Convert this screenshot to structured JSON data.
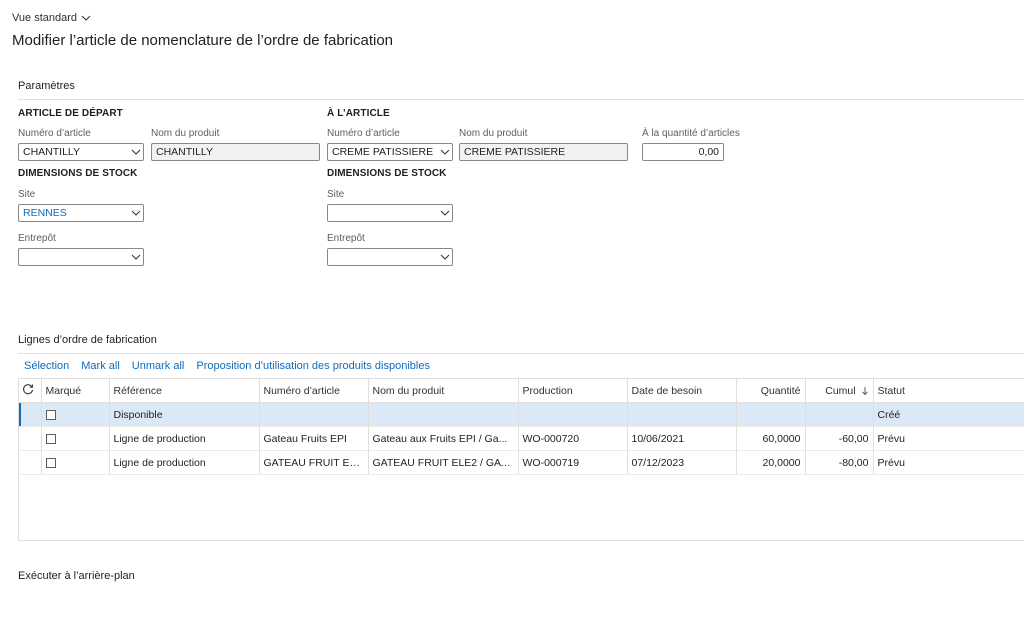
{
  "header": {
    "view_label": "Vue standard",
    "title": "Modifier l’article de nomenclature de l’ordre de fabrication"
  },
  "parameters": {
    "section_label": "Paramètres",
    "from": {
      "heading": "ARTICLE DE DÉPART",
      "item_number_label": "Numéro d’article",
      "item_number_value": "CHANTILLY",
      "product_name_label": "Nom du produit",
      "product_name_value": "CHANTILLY",
      "dims_heading": "DIMENSIONS DE STOCK",
      "site_label": "Site",
      "site_value": "RENNES",
      "warehouse_label": "Entrepôt",
      "warehouse_value": ""
    },
    "to": {
      "heading": "À L’ARTICLE",
      "item_number_label": "Numéro d’article",
      "item_number_value": "CREME PATISSIERE",
      "product_name_label": "Nom du produit",
      "product_name_value": "CREME PATISSIERE",
      "qty_label": "À la quantité d’articles",
      "qty_value": "0,00",
      "dims_heading": "DIMENSIONS DE STOCK",
      "site_label": "Site",
      "site_value": "",
      "warehouse_label": "Entrepôt",
      "warehouse_value": ""
    }
  },
  "lines": {
    "section_label": "Lignes d’ordre de fabrication",
    "toolbar": [
      "Sélection",
      "Mark all",
      "Unmark all",
      "Proposition d’utilisation des produits disponibles"
    ],
    "columns": [
      "Marqué",
      "Référence",
      "Numéro d’article",
      "Nom du produit",
      "Production",
      "Date de besoin",
      "Quantité",
      "Cumul",
      "Statut"
    ],
    "rows": [
      {
        "ref": "Disponible",
        "item": "",
        "name": "",
        "prod": "",
        "date": "",
        "qty": "",
        "cumul": "",
        "status": "Créé"
      },
      {
        "ref": "Ligne de production",
        "item": "Gateau Fruits EPI",
        "name": "Gateau aux Fruits EPI / Ga...",
        "prod": "WO-000720",
        "date": "10/06/2021",
        "qty": "60,0000",
        "cumul": "-60,00",
        "status": "Prévu"
      },
      {
        "ref": "Ligne de production",
        "item": "GATEAU FRUIT EL...",
        "name": "GATEAU FRUIT ELE2 / GAT...",
        "prod": "WO-000719",
        "date": "07/12/2023",
        "qty": "20,0000",
        "cumul": "-80,00",
        "status": "Prévu"
      }
    ]
  },
  "footer": {
    "background_label": "Exécuter à l’arrière-plan"
  }
}
